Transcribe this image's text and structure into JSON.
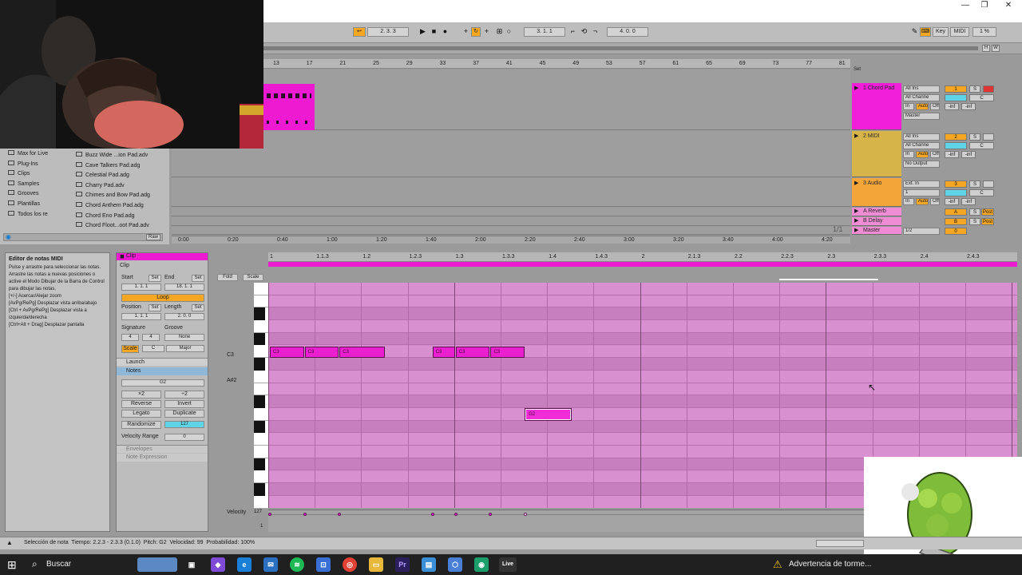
{
  "window": {
    "minimize": "—",
    "maximize": "❐",
    "close": "✕"
  },
  "transport": {
    "position": "2.  3.  3",
    "loop_start": "3.  1.  1",
    "loop_length": "4.  0.  0",
    "key_label": "Key",
    "midi_label": "MIDI",
    "cpu": "1 %"
  },
  "arrangement": {
    "bars": [
      "13",
      "17",
      "21",
      "25",
      "29",
      "33",
      "37",
      "41",
      "45",
      "49",
      "53",
      "57",
      "61",
      "65",
      "69",
      "73",
      "77",
      "81"
    ],
    "times": [
      "0:00",
      "0:20",
      "0:40",
      "1:00",
      "1:20",
      "1:40",
      "2:00",
      "2:20",
      "2:40",
      "3:00",
      "3:20",
      "3:40",
      "4:00",
      "4:20"
    ],
    "page": "1/1"
  },
  "browser": {
    "categories": [
      "Max for Live",
      "Plug-Ins",
      "Clips",
      "Samples",
      "Grooves",
      "Plantillas",
      "Todos los re"
    ],
    "files": [
      "Buzz Wide ...ion Pad.adv",
      "Cave Talkers Pad.adg",
      "Celestial Pad.adg",
      "Charry Pad.adv",
      "Chimes and Bow Pad.adg",
      "Chord Anthem Pad.adg",
      "Chord Eno Pad.adg",
      "Chord Floot...oot Pad.adv"
    ],
    "raw_btn": "Raw"
  },
  "tracks": [
    {
      "name": "1 Chord Pad",
      "input": "All Ins",
      "channel": "All Channe",
      "output": "Master",
      "num": "1",
      "color": "#f01ed6"
    },
    {
      "name": "2 MIDI",
      "input": "All Ins",
      "channel": "All Channe",
      "output": "No Output",
      "num": "2",
      "color": "#d6b44a"
    },
    {
      "name": "3 Audio",
      "input": "Ext. In",
      "channel": "1",
      "output": "",
      "num": "3",
      "color": "#f4a53a"
    },
    {
      "name": "A Reverb",
      "num": "A",
      "color": "#f08cd4"
    },
    {
      "name": "B Delay",
      "num": "B",
      "color": "#f08cd4"
    },
    {
      "name": "Master",
      "num": "0",
      "color": "#f08cd4",
      "io": "1/2"
    }
  ],
  "mixer": {
    "in": "In",
    "auto": "Auto",
    "off": "Off",
    "solo": "S",
    "post": "Post",
    "inf": "-inf",
    "c": "C",
    "set": "Set"
  },
  "info": {
    "title": "Editor de notas MIDI",
    "body": "Pulse y arrastre para seleccionar las notas. Arrastre las notas a nuevas posiciones o active el Modo Dibujar de la Barra de Control para dibujar las notas.\n[+/-] Acercar/Alejar zoom\n[AvPg/RePg] Desplazar vista arriba/abajo\n[Ctrl + AvPg/RePg] Desplazar vista a izquierda/derecha\n[Ctrl+Alt + Drag] Desplazar pantalla"
  },
  "clip": {
    "header": "Clip",
    "sub": "Clip",
    "start_label": "Start",
    "set_label": "Set",
    "end_label": "End",
    "start": "1.  1.  1",
    "end": "18.  1.  1",
    "loop": "Loop",
    "position_label": "Position",
    "length_label": "Length",
    "position": "1.  1.  1",
    "length": "2.  0.  0",
    "signature_label": "Signature",
    "groove_label": "Groove",
    "sig_num": "4",
    "sig_den": "4",
    "groove": "None",
    "scale_btn": "Scale",
    "scale_root": "C",
    "scale_mode": "Major",
    "launch": "Launch",
    "notes": "Notes",
    "pitch": "G2",
    "x2": "×2",
    "half": "÷2",
    "reverse": "Reverse",
    "invert": "Invert",
    "legato": "Legato",
    "duplicate": "Duplicate",
    "randomize": "Randomize",
    "rand_val": "127",
    "velrange_label": "Velocity Range",
    "velrange": "0",
    "envelopes": "Envelopes",
    "note_expr": "Note Expression"
  },
  "editor": {
    "fold": "Fold",
    "scale": "Scale",
    "ruler": [
      "1",
      "1.1.3",
      "1.2",
      "1.2.3",
      "1.3",
      "1.3.3",
      "1.4",
      "1.4.3",
      "2",
      "2.1.3",
      "2.2",
      "2.2.3",
      "2.3",
      "2.3.3",
      "2.4",
      "2.4.3"
    ],
    "key_labels": [
      "C3",
      "A#2"
    ],
    "velocity_label": "Velocity",
    "vel_max": "127",
    "vel_min": "1",
    "notes": [
      {
        "pitch": "C3",
        "start": 0.0,
        "len": 0.375
      },
      {
        "pitch": "C3",
        "start": 0.375,
        "len": 0.375
      },
      {
        "pitch": "C3",
        "start": 0.75,
        "len": 0.5
      },
      {
        "pitch": "C3",
        "start": 1.75,
        "len": 0.25
      },
      {
        "pitch": "C3",
        "start": 2.0,
        "len": 0.375
      },
      {
        "pitch": "C3",
        "start": 2.375,
        "len": 0.375
      },
      {
        "pitch": "G2",
        "start": 2.75,
        "len": 0.5,
        "selected": true
      }
    ]
  },
  "status": "Selección de nota  Tiempo: 2.2.3 - 2.3.3 (0.1.0)  Pitch: G2  Velocidad: 99  Probabilidad: 100%",
  "taskbar": {
    "search": "Buscar",
    "warning": "Advertencia de torme..."
  }
}
